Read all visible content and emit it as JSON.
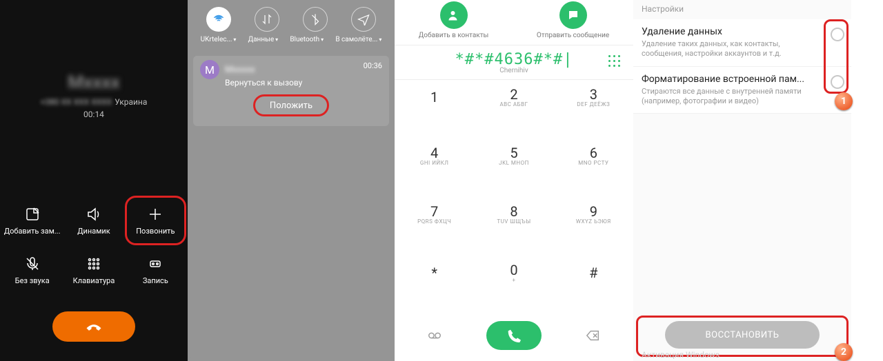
{
  "panel1": {
    "contact": "Mxxxx",
    "number_masked": "+380 XX XXX XXXX",
    "country": "Украина",
    "duration": "00:14",
    "buttons": {
      "add_note": "Добавить зам...",
      "speaker": "Динамик",
      "call": "Позвонить",
      "mute": "Без звука",
      "keypad": "Клавиатура",
      "record": "Запись"
    }
  },
  "panel2": {
    "qs": {
      "wifi": "UKrtelec...",
      "data": "Данные",
      "bluetooth": "Bluetooth",
      "airplane": "В самолёте..."
    },
    "avatar_letter": "М",
    "contact_masked": "Mxxxxx",
    "return_text": "Вернуться к вызову",
    "duration": "00:36",
    "hangup_label": "Положить"
  },
  "panel3": {
    "add_contact": "Добавить в контакты",
    "send_message": "Отправить сообщение",
    "input": "*#*#4636#*#|",
    "sublabel": "Chernihiv",
    "keys": [
      {
        "n": "1",
        "l": " "
      },
      {
        "n": "2",
        "l": "ABC АБВГ"
      },
      {
        "n": "3",
        "l": "DEF ДЕЁЖЗ"
      },
      {
        "n": "4",
        "l": "GHI ИЙКЛ"
      },
      {
        "n": "5",
        "l": "JKL МНОП"
      },
      {
        "n": "6",
        "l": "MNO РСТУ"
      },
      {
        "n": "7",
        "l": "PQRS ФХЦЧ"
      },
      {
        "n": "8",
        "l": "TUV ШЩЪЫ"
      },
      {
        "n": "9",
        "l": "WXYZ ЬЭЮЯ"
      },
      {
        "n": "*",
        "l": " "
      },
      {
        "n": "0",
        "l": "+"
      },
      {
        "n": "#",
        "l": " "
      }
    ]
  },
  "panel4": {
    "header": "Настройки",
    "items": [
      {
        "t": "Удаление данных",
        "d": "Удаление таких данных, как контакты, сообщения, настройки аккаунтов и т.д."
      },
      {
        "t": "Форматирование встроенной пам...",
        "d": "Стираются все данные с внутренней памяти (например, фотографии и видео)"
      }
    ],
    "restore": "ВОССТАНОВИТЬ",
    "callout1": "1",
    "callout2": "2",
    "watermark": "Активация Windows"
  }
}
